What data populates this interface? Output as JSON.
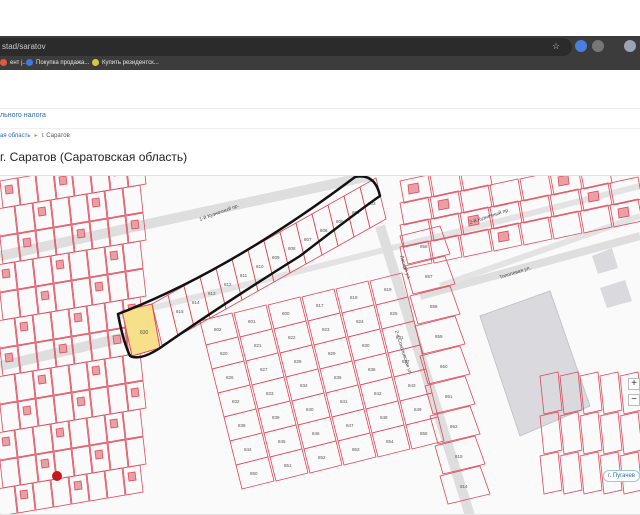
{
  "browser": {
    "url": "stad/saratov",
    "bookmarks": [
      {
        "label": "ент j...",
        "color": "#e05a3a"
      },
      {
        "label": "Покупка продажа...",
        "color": "#3d7be0"
      },
      {
        "label": "Купить резидентск...",
        "color": "#d9c93a"
      }
    ]
  },
  "page": {
    "nav_link": "льного налога",
    "breadcrumbs": {
      "region": "ая область",
      "city": "г. Саратов"
    },
    "title": "г. Саратов (Саратовская область)",
    "bottom_button": "г. Пугачев"
  },
  "map": {
    "highlight_parcel": "830",
    "plot_numbers": [
      "815",
      "814",
      "813",
      "812",
      "811",
      "810",
      "809",
      "808",
      "807",
      "806",
      "805",
      "804",
      "803",
      "802",
      "801",
      "800",
      "817",
      "818",
      "819",
      "820",
      "821",
      "822",
      "823",
      "824",
      "825",
      "826",
      "827",
      "828",
      "829",
      "830",
      "831",
      "832",
      "833",
      "834",
      "835",
      "836",
      "837",
      "838",
      "839",
      "840",
      "841",
      "842",
      "843",
      "844",
      "845",
      "846",
      "847",
      "848",
      "849",
      "850",
      "851",
      "852",
      "853",
      "854",
      "855",
      "856",
      "857",
      "858",
      "859",
      "860",
      "861",
      "862"
    ],
    "street_labels": [
      "1-й Кузнечный пр.",
      "2-й Кузнечный пр.",
      "Лесная ул.",
      "2-я Соколовская ул.",
      "Тополевая ул."
    ],
    "zoom": {
      "in": "+",
      "out": "−"
    },
    "colors": {
      "parcel_line": "#e0495a",
      "building": "#e8a0a4",
      "highlight": "#f6e08a",
      "outline": "#111111"
    }
  }
}
